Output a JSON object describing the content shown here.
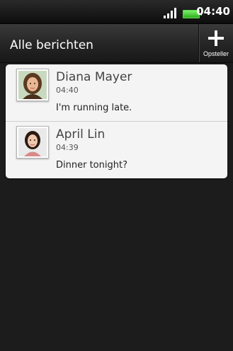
{
  "status_bar": {
    "time": "04:40",
    "icons": [
      "signal-icon",
      "battery-icon"
    ],
    "battery_color": "#4cd636"
  },
  "header": {
    "title": "Alle berichten",
    "compose_label": "Opsteller",
    "compose_icon": "plus-icon"
  },
  "messages": [
    {
      "name": "Diana Mayer",
      "time": "04:40",
      "preview": "I'm running late.",
      "avatar_icon": "contact-photo-icon"
    },
    {
      "name": "April Lin",
      "time": "04:39",
      "preview": "Dinner tonight?",
      "avatar_icon": "contact-photo-icon"
    }
  ],
  "colors": {
    "background": "#1c1c1c",
    "list_background": "#f4f4f4"
  }
}
